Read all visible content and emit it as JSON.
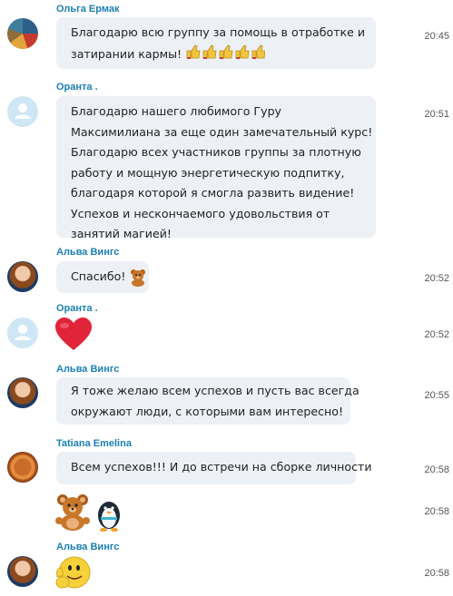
{
  "messages": [
    {
      "sender": "Ольга Ермак",
      "avatar": "olga-avatar",
      "lines": [
        "Благодарю всю группу за помощь в отработке и",
        "затирании кармы!"
      ],
      "time": "20:45"
    },
    {
      "sender": "Оранта .",
      "avatar": "default-avatar",
      "lines": [
        "Благодарю нашего любимого Гуру",
        "Максимилиана за еще один замечательный курс!",
        "Благодарю всех участников группы за плотную",
        "работу и мощную энергетическую подпитку,",
        "благодаря которой я смогла развить  видение!",
        "Успехов и нескончаемого удовольствия от",
        "занятий магией!"
      ],
      "time": "20:51"
    },
    {
      "sender": "Альва Вингс",
      "avatar": "alva-avatar",
      "lines": [
        "Спасибо!"
      ],
      "time": "20:52"
    },
    {
      "sender": "Оранта .",
      "avatar": "default-avatar",
      "lines": [],
      "time": "20:52"
    },
    {
      "sender": "Альва Вингс",
      "avatar": "alva-avatar",
      "lines": [
        "Я тоже желаю всем успехов и пусть вас всегда",
        "окружают люди, с которыми вам интересно!"
      ],
      "time": "20:55"
    },
    {
      "sender": "Tatiana Emelina",
      "avatar": "tatiana-avatar",
      "lines": [
        "Всем успехов!!! И до встречи на сборке личности"
      ],
      "time": "20:58"
    },
    {
      "sender": "",
      "avatar": "",
      "lines": [],
      "time": "20:58"
    },
    {
      "sender": "Альва Вингс",
      "avatar": "alva-avatar",
      "lines": [],
      "time": "20:58"
    }
  ],
  "icons": {
    "thumbs": "thumbs-up-icon",
    "bear": "teddy-bear-icon",
    "heart": "heart-icon",
    "penguin": "penguin-icon",
    "wave": "waving-smiley-icon"
  },
  "colors": {
    "sender_name": "#1a7fb5",
    "bubble_bg": "#edf0f5",
    "heart": "#e0243a"
  }
}
